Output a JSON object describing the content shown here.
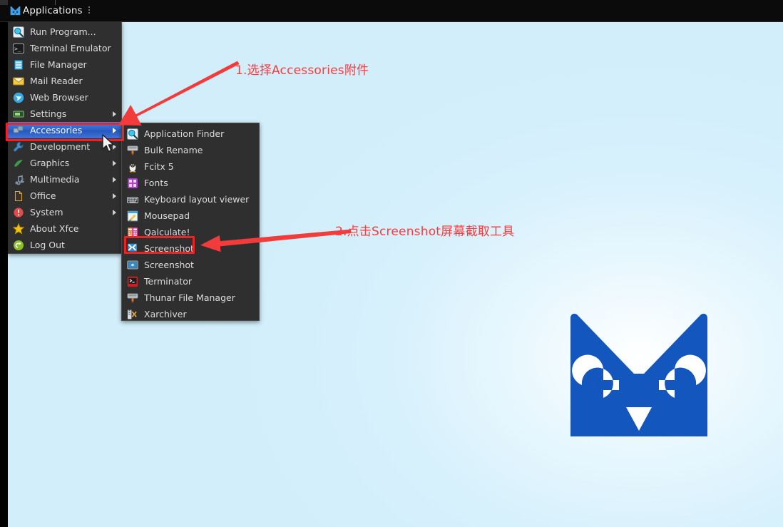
{
  "panel": {
    "applications_label": "Applications",
    "grip_name": "panel-handle"
  },
  "root_menu": {
    "items": [
      {
        "label": "Run Program...",
        "icon": "magnifier-icon",
        "submenu": false
      },
      {
        "label": "Terminal Emulator",
        "icon": "terminal-icon",
        "submenu": false
      },
      {
        "label": "File Manager",
        "icon": "file-manager-icon",
        "submenu": false
      },
      {
        "label": "Mail Reader",
        "icon": "mail-icon",
        "submenu": false
      },
      {
        "label": "Web Browser",
        "icon": "globe-icon",
        "submenu": false
      },
      {
        "label": "Settings",
        "icon": "settings-icon",
        "submenu": true
      },
      {
        "label": "Accessories",
        "icon": "accessories-icon",
        "submenu": true,
        "selected": true
      },
      {
        "label": "Development",
        "icon": "wrench-icon",
        "submenu": true
      },
      {
        "label": "Graphics",
        "icon": "graphics-icon",
        "submenu": true
      },
      {
        "label": "Multimedia",
        "icon": "music-note-icon",
        "submenu": true
      },
      {
        "label": "Office",
        "icon": "document-icon",
        "submenu": true
      },
      {
        "label": "System",
        "icon": "system-icon",
        "submenu": true
      },
      {
        "label": "About Xfce",
        "icon": "star-icon",
        "submenu": false
      },
      {
        "label": "Log Out",
        "icon": "logout-icon",
        "submenu": false
      }
    ]
  },
  "sub_menu": {
    "items": [
      {
        "label": "Application Finder",
        "icon": "magnifier-icon"
      },
      {
        "label": "Bulk Rename",
        "icon": "bulk-rename-icon"
      },
      {
        "label": "Fcitx 5",
        "icon": "fcitx-penguin-icon"
      },
      {
        "label": "Fonts",
        "icon": "fonts-icon"
      },
      {
        "label": "Keyboard layout viewer",
        "icon": "keyboard-icon"
      },
      {
        "label": "Mousepad",
        "icon": "mousepad-icon"
      },
      {
        "label": "Qalculate!",
        "icon": "qalculate-icon"
      },
      {
        "label": "Screenshot",
        "icon": "screenshot-xfce-icon",
        "highlighted": true
      },
      {
        "label": "Screenshot",
        "icon": "screenshot-gnome-icon"
      },
      {
        "label": "Terminator",
        "icon": "terminator-icon"
      },
      {
        "label": "Thunar File Manager",
        "icon": "thunar-icon"
      },
      {
        "label": "Xarchiver",
        "icon": "xarchiver-icon"
      }
    ]
  },
  "annotations": {
    "note1": "1.选择Accessories附件",
    "note2": "2.点击Screenshot屏幕截取工具",
    "color": "#fb3b3b",
    "box_color": "#ee2222"
  },
  "desktop": {
    "logo_name": "xfce-mouse-logo",
    "logo_color": "#1356bd",
    "background_color": "#d6f0fc"
  }
}
